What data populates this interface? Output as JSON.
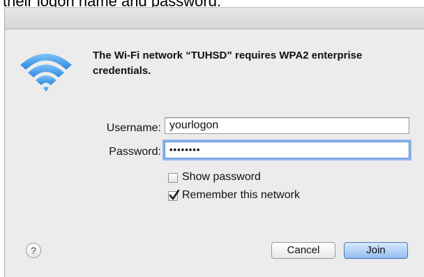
{
  "caption": "their logon name and password:",
  "dialog": {
    "message": "The Wi-Fi network “TUHSD” requires WPA2 enterprise credentials.",
    "icon": "wifi-icon",
    "username": {
      "label": "Username:",
      "value": "yourlogon"
    },
    "password": {
      "label": "Password:",
      "value": "••••••••"
    },
    "show_password": {
      "label": "Show password",
      "checked": false
    },
    "remember_network": {
      "label": "Remember this network",
      "checked": true
    },
    "help_label": "?",
    "cancel_label": "Cancel",
    "join_label": "Join"
  },
  "colors": {
    "accent": "#5a8ed6",
    "wifi": "#3d97e8",
    "dialog_bg": "#ececec"
  }
}
